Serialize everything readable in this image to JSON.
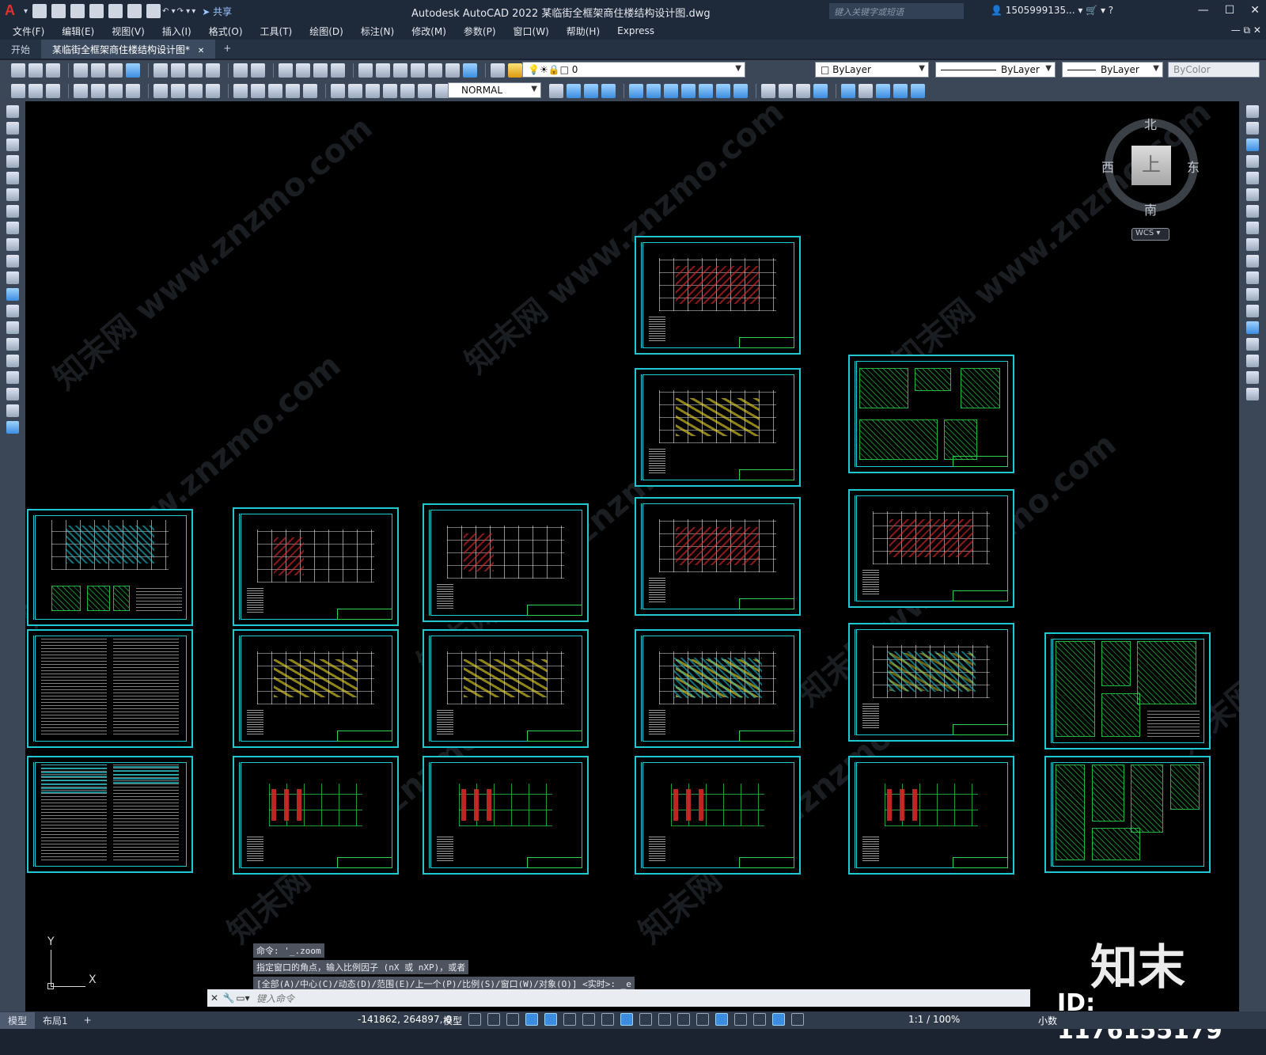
{
  "window": {
    "title": "Autodesk AutoCAD 2022    某临街全框架商住楼结构设计图.dwg",
    "share_label": "共享",
    "search_placeholder": "键入关键字或短语",
    "user": "1505999135...",
    "minimize": "—",
    "maximize": "☐",
    "close": "✕"
  },
  "menu": [
    "文件(F)",
    "编辑(E)",
    "视图(V)",
    "插入(I)",
    "格式(O)",
    "工具(T)",
    "绘图(D)",
    "标注(N)",
    "修改(M)",
    "参数(P)",
    "窗口(W)",
    "帮助(H)",
    "Express"
  ],
  "tabs": {
    "start": "开始",
    "doc": "某临街全框架商住楼结构设计图*",
    "close": "✕",
    "add": "+"
  },
  "toolbar": {
    "layer_value": "0",
    "color": "ByLayer",
    "linetype": "ByLayer",
    "lineweight": "ByLayer",
    "plotstyle": "ByColor",
    "dimstyle": "NORMAL"
  },
  "viewcube": {
    "north": "北",
    "south": "南",
    "east": "东",
    "west": "西",
    "face": "上",
    "wcs": "WCS"
  },
  "ucs": {
    "x": "X",
    "y": "Y"
  },
  "command": {
    "history": [
      "命令: '_.zoom",
      "指定窗口的角点，输入比例因子 (nX 或 nXP)，或者",
      "[全部(A)/中心(C)/动态(D)/范围(E)/上一个(P)/比例(S)/窗口(W)/对象(O)] <实时>: _e"
    ],
    "placeholder": "键入命令"
  },
  "status": {
    "model_tab": "模型",
    "layout_tab": "布局1",
    "add": "+",
    "coords": "-141862, 264897, 0",
    "space": "模型",
    "scale": "1:1 / 100%",
    "units": "小数"
  },
  "watermark": {
    "site": "知末网 www.znzmo.com",
    "brand": "知末",
    "id": "ID: 1176155179"
  },
  "colors": {
    "canvas": "#000000",
    "sheet_border": "#1fc7d1",
    "title_block": "#2ad34a",
    "ui_dark": "#1e2a3a",
    "toolbar": "#3b4657"
  }
}
